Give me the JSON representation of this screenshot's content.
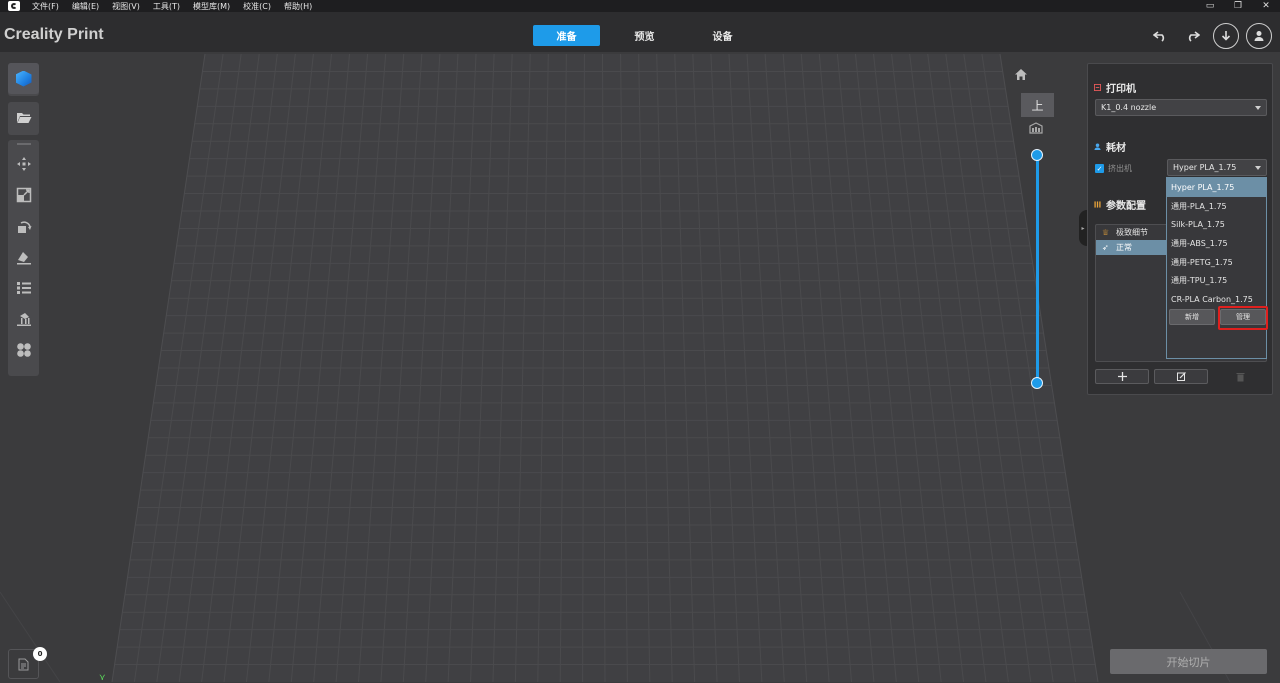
{
  "menubar": {
    "items": [
      "文件(F)",
      "编辑(E)",
      "视图(V)",
      "工具(T)",
      "模型库(M)",
      "校准(C)",
      "帮助(H)"
    ]
  },
  "header": {
    "brand": "Creality Print",
    "tabs": [
      {
        "label": "准备",
        "active": true
      },
      {
        "label": "预览",
        "active": false
      },
      {
        "label": "设备",
        "active": false
      }
    ],
    "icons": [
      "undo-icon",
      "redo-icon",
      "download-icon",
      "user-icon"
    ]
  },
  "left_toolbar": {
    "icons": [
      "cube-icon",
      "folder-open-icon",
      "move-icon",
      "scale-icon",
      "rotate-icon",
      "lay-flat-icon",
      "list-icon",
      "support-icon",
      "arrange-icon"
    ]
  },
  "view_tools": {
    "top_view_label": "上",
    "perspective_label": "⩊"
  },
  "layer_slider": {
    "top_value": 1,
    "bottom_value": 0
  },
  "panel": {
    "printer": {
      "title": "打印机",
      "selected": "K1_0.4 nozzle"
    },
    "filament": {
      "title": "耗材",
      "extruder_label": "挤出机",
      "extruder_checked": true,
      "selected": "Hyper PLA_1.75"
    },
    "params": {
      "title": "参数配置",
      "items": [
        {
          "label": "极致细节",
          "selected": false
        },
        {
          "label": "正常",
          "selected": true
        }
      ]
    }
  },
  "dropdown": {
    "options": [
      {
        "label": "Hyper PLA_1.75",
        "selected": true
      },
      {
        "label": "通用-PLA_1.75",
        "selected": false
      },
      {
        "label": "Silk-PLA_1.75",
        "selected": false
      },
      {
        "label": "通用-ABS_1.75",
        "selected": false
      },
      {
        "label": "通用-PETG_1.75",
        "selected": false
      },
      {
        "label": "通用-TPU_1.75",
        "selected": false
      },
      {
        "label": "CR-PLA Carbon_1.75",
        "selected": false
      }
    ],
    "new_label": "新增",
    "manage_label": "管理"
  },
  "bottom": {
    "start_slice_label": "开始切片",
    "log_badge_count": "0"
  },
  "colors": {
    "accent": "#1e9be9",
    "selected_row": "#6c8fa6",
    "highlight": "#e0201e"
  }
}
